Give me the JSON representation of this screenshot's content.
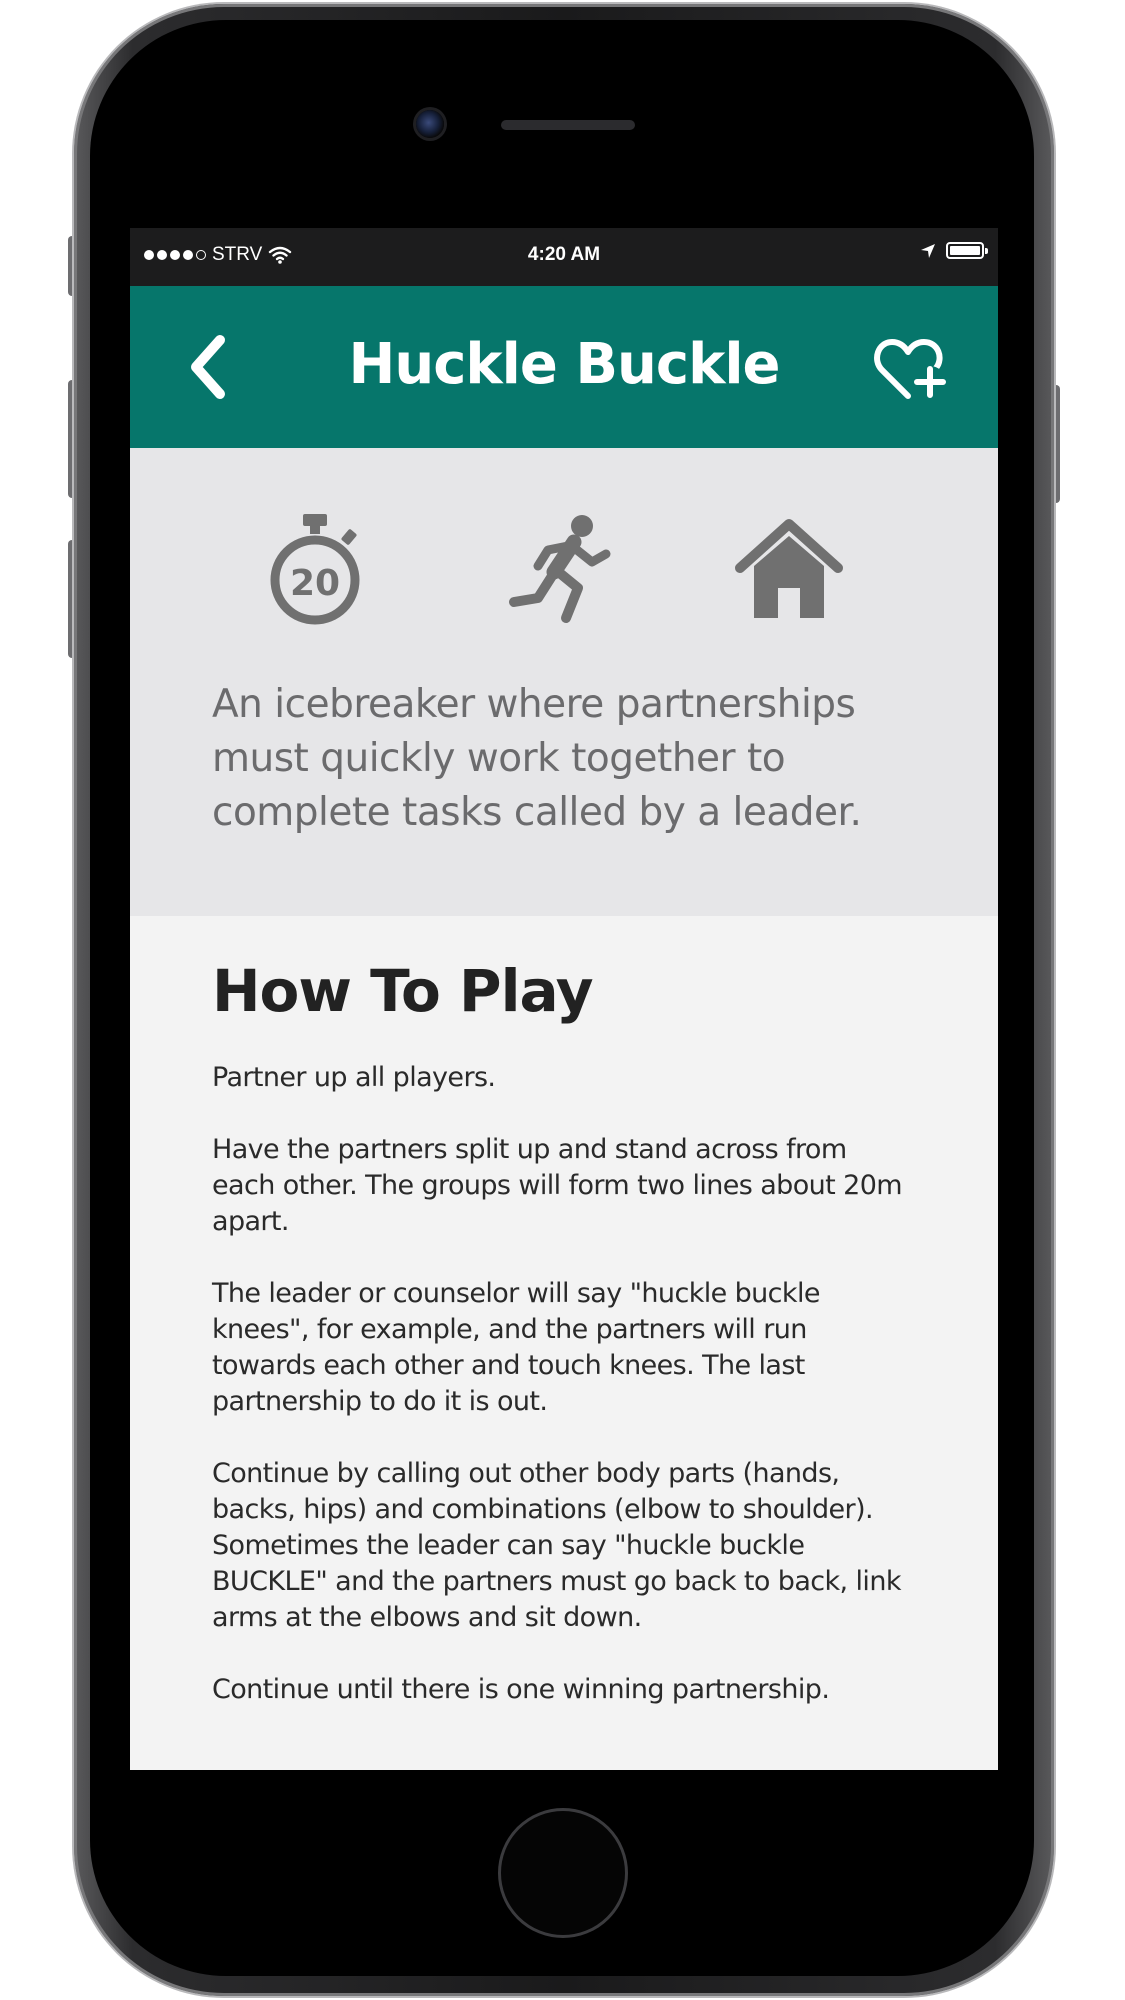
{
  "status_bar": {
    "carrier": "STRV",
    "time": "4:20 AM"
  },
  "nav": {
    "title": "Huckle Buckle"
  },
  "summary": {
    "duration_minutes": "20",
    "icons": [
      "stopwatch-icon",
      "running-person-icon",
      "house-icon"
    ],
    "description": "An icebreaker where partnerships must quickly work together to complete tasks called by a leader."
  },
  "how_to_play": {
    "title": "How To Play",
    "steps": [
      "Partner up all players.",
      "Have the partners split up and stand across from each other. The groups will form two lines about 20m apart.",
      "The leader or counselor will say \"huckle buckle knees\", for example, and the partners will run towards each other and touch knees. The last partnership to do it is out.",
      "Continue by calling out other body parts (hands, backs, hips) and combinations (elbow to shoulder). Sometimes the leader can say \"huckle buckle BUCKLE\" and the partners must go back to back, link arms at the elbows and sit down.",
      "Continue until there is one winning partnership."
    ]
  },
  "colors": {
    "nav_background": "#06766b",
    "summary_background": "#e6e6e8",
    "icon_gray": "#707070",
    "content_background": "#f3f3f3"
  }
}
